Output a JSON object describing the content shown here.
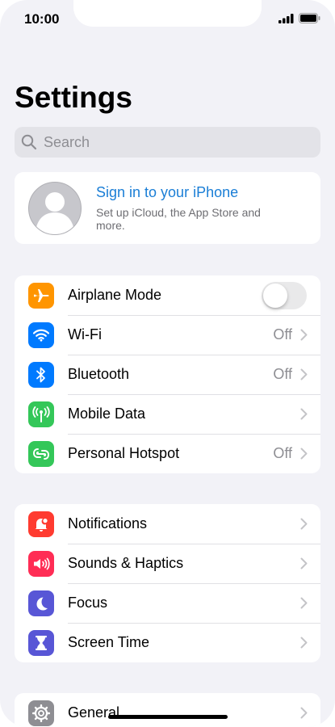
{
  "status": {
    "time": "10:00"
  },
  "page": {
    "title": "Settings"
  },
  "search": {
    "placeholder": "Search"
  },
  "account": {
    "title": "Sign in to your iPhone",
    "subtitle": "Set up iCloud, the App Store and more."
  },
  "group1": [
    {
      "label": "Airplane Mode",
      "icon": "airplane-icon",
      "color": "#ff9500",
      "toggle": false
    },
    {
      "label": "Wi-Fi",
      "icon": "wifi-icon",
      "color": "#007aff",
      "value": "Off"
    },
    {
      "label": "Bluetooth",
      "icon": "bluetooth-icon",
      "color": "#007aff",
      "value": "Off"
    },
    {
      "label": "Mobile Data",
      "icon": "antenna-icon",
      "color": "#34c759",
      "value": ""
    },
    {
      "label": "Personal Hotspot",
      "icon": "hotspot-icon",
      "color": "#34c759",
      "value": "Off"
    }
  ],
  "group2": [
    {
      "label": "Notifications",
      "icon": "bell-icon",
      "color": "#ff3b30"
    },
    {
      "label": "Sounds & Haptics",
      "icon": "speaker-icon",
      "color": "#ff2d55"
    },
    {
      "label": "Focus",
      "icon": "moon-icon",
      "color": "#5856d6"
    },
    {
      "label": "Screen Time",
      "icon": "hourglass-icon",
      "color": "#5856d6"
    }
  ],
  "group3": [
    {
      "label": "General",
      "icon": "gear-icon",
      "color": "#8e8e93"
    }
  ]
}
